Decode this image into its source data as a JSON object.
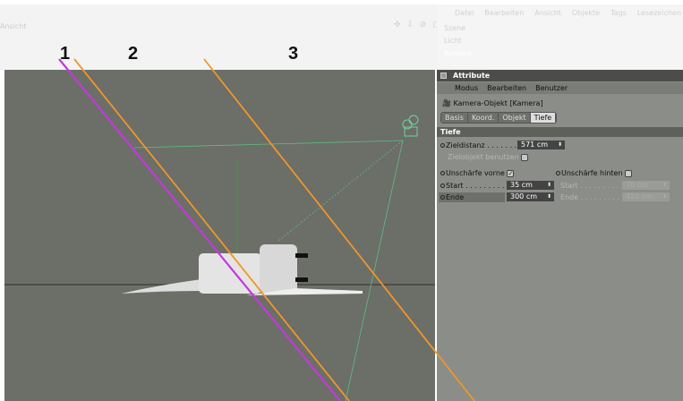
{
  "viewport": {
    "title": "Ansicht",
    "labels": [
      "1",
      "2",
      "3"
    ],
    "icons": "✣ ⇩ ⊘ ▢"
  },
  "object_manager": {
    "menu": [
      "Datei",
      "Bearbeiten",
      "Ansicht",
      "Objekte",
      "Tags",
      "Lesezeichen"
    ],
    "objects": [
      "Szene",
      "Licht",
      "Kamera"
    ]
  },
  "attributes": {
    "header": "Attribute",
    "menu": [
      "Modus",
      "Bearbeiten",
      "Benutzer"
    ],
    "object_title": "Kamera-Objekt [Kamera]",
    "tabs": [
      "Basis",
      "Koord.",
      "Objekt",
      "Tiefe"
    ],
    "active_tab": "Tiefe",
    "section": "Tiefe",
    "zieldistanz_label": "Zieldistanz . . . . . . . .",
    "zieldistanz": "571 cm",
    "zielobjekt_label": "Zielobjekt benutzen",
    "front_label": "Unschärfe vorne",
    "back_label": "Unschärfe hinten",
    "start_label": "Start . . . . . . . . . .",
    "end_label": "Ende",
    "front_start": "35 cm",
    "front_end": "300 cm",
    "back_start_label": "Start . . . . . . . . . .",
    "back_end_label": "Ende . . . . . . . . . .",
    "back_start": "70 cm",
    "back_end": "450 cm"
  }
}
